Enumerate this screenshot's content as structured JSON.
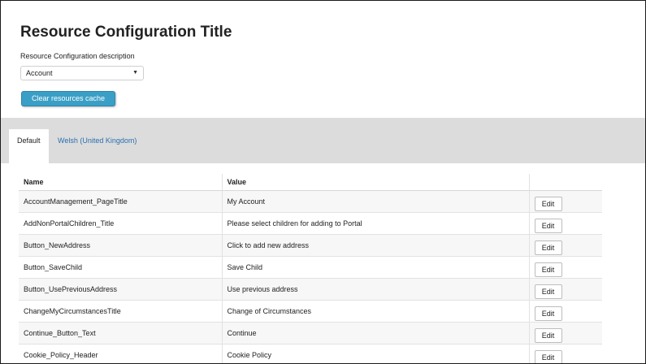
{
  "page": {
    "title": "Resource Configuration Title",
    "description": "Resource Configuration description"
  },
  "resource_select": {
    "value": "Account"
  },
  "clear_cache_button": {
    "label": "Clear resources cache"
  },
  "tabs": [
    {
      "label": "Default",
      "active": true
    },
    {
      "label": "Welsh (United Kingdom)",
      "active": false
    }
  ],
  "table": {
    "headers": {
      "name": "Name",
      "value": "Value"
    },
    "edit_label": "Edit",
    "rows": [
      {
        "name": "AccountManagement_PageTitle",
        "value": "My Account"
      },
      {
        "name": "AddNonPortalChildren_Title",
        "value": "Please select children for adding to Portal"
      },
      {
        "name": "Button_NewAddress",
        "value": "Click to add new address"
      },
      {
        "name": "Button_SaveChild",
        "value": "Save Child"
      },
      {
        "name": "Button_UsePreviousAddress",
        "value": "Use previous address"
      },
      {
        "name": "ChangeMyCircumstancesTitle",
        "value": "Change of Circumstances"
      },
      {
        "name": "Continue_Button_Text",
        "value": "Continue"
      },
      {
        "name": "Cookie_Policy_Header",
        "value": "Cookie Policy"
      }
    ]
  },
  "colors": {
    "accent_button": "#3a9fc6",
    "tab_link": "#2a6fb0",
    "tab_bar": "#dcdcdc"
  },
  "icons": {
    "select_chevron": "chevron-down-icon"
  }
}
